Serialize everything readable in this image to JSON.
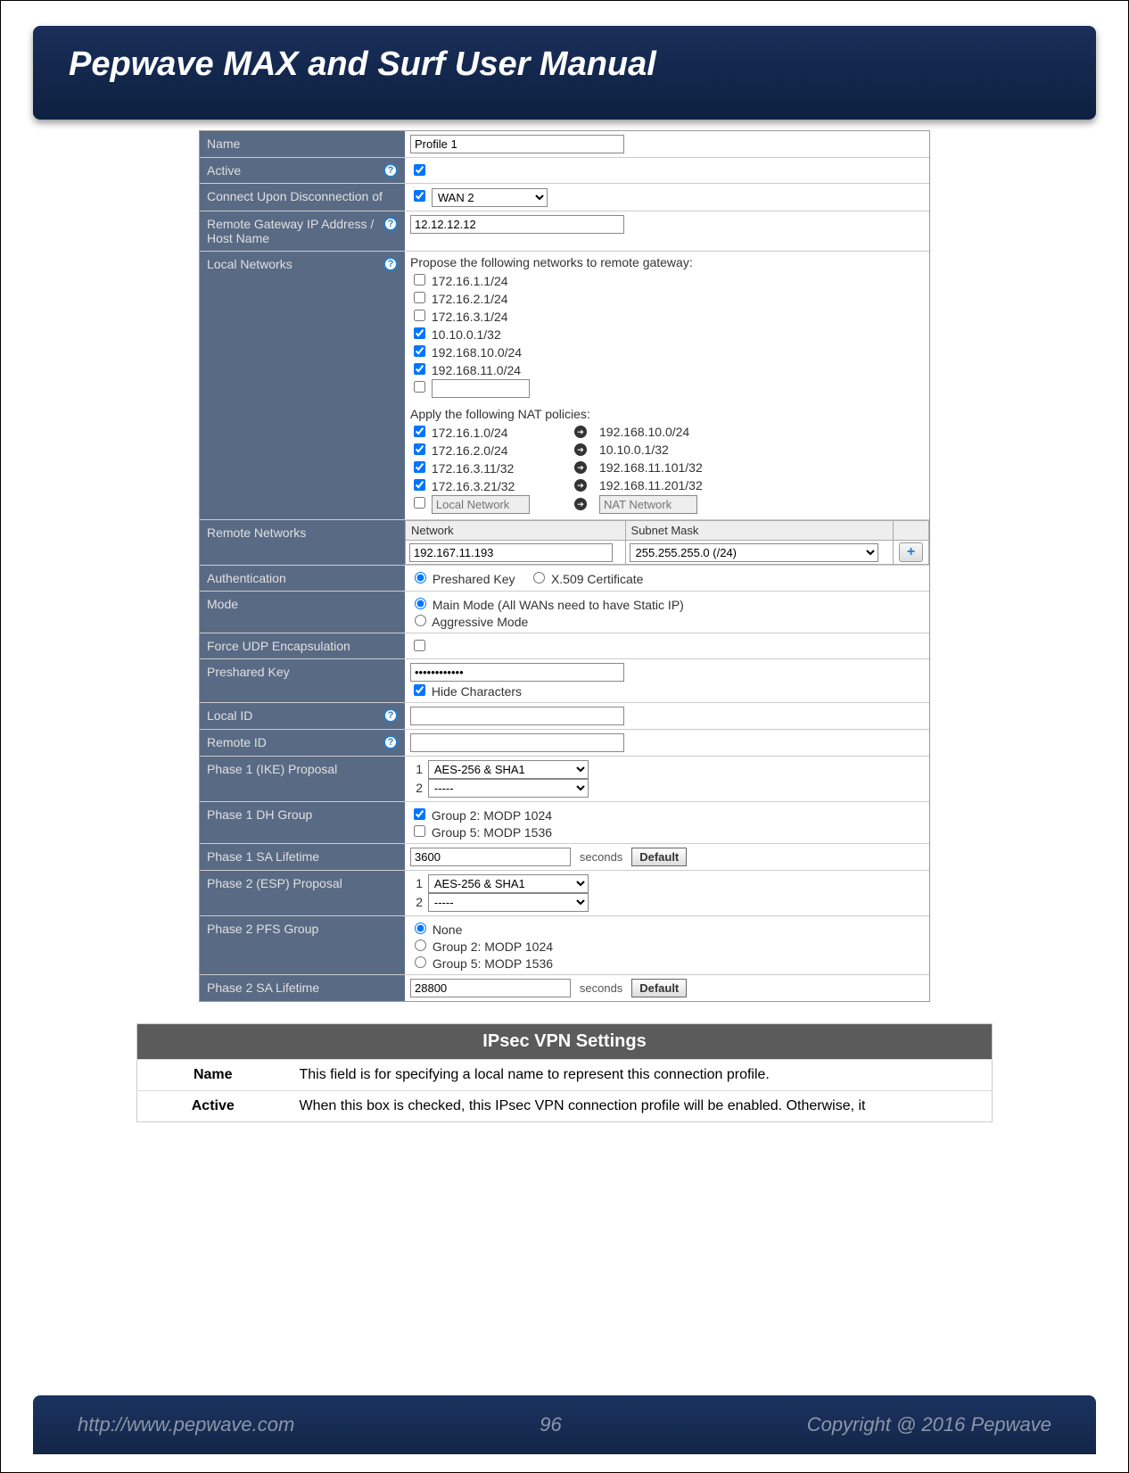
{
  "doc": {
    "title": "Pepwave MAX and Surf User Manual",
    "footer_url": "http://www.pepwave.com",
    "page_number": "96",
    "copyright": "Copyright @ 2016 Pepwave"
  },
  "form": {
    "name": {
      "label": "Name",
      "value": "Profile 1"
    },
    "active": {
      "label": "Active",
      "checked": true
    },
    "connect_upon": {
      "label": "Connect Upon Disconnection of",
      "checked": true,
      "select": "WAN 2"
    },
    "remote_gateway": {
      "label": "Remote Gateway IP Address / Host Name",
      "value": "12.12.12.12"
    },
    "local_networks": {
      "label": "Local Networks",
      "propose_header": "Propose the following networks to remote gateway:",
      "propose": [
        {
          "checked": false,
          "text": "172.16.1.1/24"
        },
        {
          "checked": false,
          "text": "172.16.2.1/24"
        },
        {
          "checked": false,
          "text": "172.16.3.1/24"
        },
        {
          "checked": true,
          "text": "10.10.0.1/32"
        },
        {
          "checked": true,
          "text": "192.168.10.0/24"
        },
        {
          "checked": true,
          "text": "192.168.11.0/24"
        }
      ],
      "nat_header": "Apply the following NAT policies:",
      "nat": [
        {
          "checked": true,
          "left": "172.16.1.0/24",
          "right": "192.168.10.0/24"
        },
        {
          "checked": true,
          "left": "172.16.2.0/24",
          "right": "10.10.0.1/32"
        },
        {
          "checked": true,
          "left": "172.16.3.11/32",
          "right": "192.168.11.101/32"
        },
        {
          "checked": true,
          "left": "172.16.3.21/32",
          "right": "192.168.11.201/32"
        }
      ],
      "nat_local_ph": "Local Network",
      "nat_nat_ph": "NAT Network"
    },
    "remote_networks": {
      "label": "Remote Networks",
      "col_network": "Network",
      "col_subnet": "Subnet Mask",
      "network": "192.167.11.193",
      "subnet": "255.255.255.0 (/24)"
    },
    "authentication": {
      "label": "Authentication",
      "opt1": "Preshared Key",
      "opt2": "X.509 Certificate"
    },
    "mode": {
      "label": "Mode",
      "opt1": "Main Mode (All WANs need to have Static IP)",
      "opt2": "Aggressive Mode"
    },
    "force_udp": {
      "label": "Force UDP Encapsulation"
    },
    "preshared": {
      "label": "Preshared Key",
      "hide_label": "Hide Characters",
      "value": "************"
    },
    "local_id": {
      "label": "Local ID"
    },
    "remote_id": {
      "label": "Remote ID"
    },
    "phase1_proposal": {
      "label": "Phase 1 (IKE) Proposal",
      "n1": "1",
      "v1": "AES-256 & SHA1",
      "n2": "2",
      "v2": "-----"
    },
    "phase1_dh": {
      "label": "Phase 1 DH Group",
      "opt1": "Group 2: MODP 1024",
      "opt2": "Group 5: MODP 1536"
    },
    "phase1_sa": {
      "label": "Phase 1 SA Lifetime",
      "value": "3600",
      "unit": "seconds",
      "btn": "Default"
    },
    "phase2_proposal": {
      "label": "Phase 2 (ESP) Proposal",
      "n1": "1",
      "v1": "AES-256 & SHA1",
      "n2": "2",
      "v2": "-----"
    },
    "phase2_pfs": {
      "label": "Phase 2 PFS Group",
      "opt0": "None",
      "opt1": "Group 2: MODP 1024",
      "opt2": "Group 5: MODP 1536"
    },
    "phase2_sa": {
      "label": "Phase 2 SA Lifetime",
      "value": "28800",
      "unit": "seconds",
      "btn": "Default"
    }
  },
  "settings_table": {
    "header": "IPsec VPN Settings",
    "rows": [
      {
        "field": "Name",
        "desc": "This field is for specifying a local name to represent this connection profile."
      },
      {
        "field": "Active",
        "desc": "When this box is checked, this IPsec VPN connection profile will be enabled. Otherwise, it"
      }
    ]
  }
}
